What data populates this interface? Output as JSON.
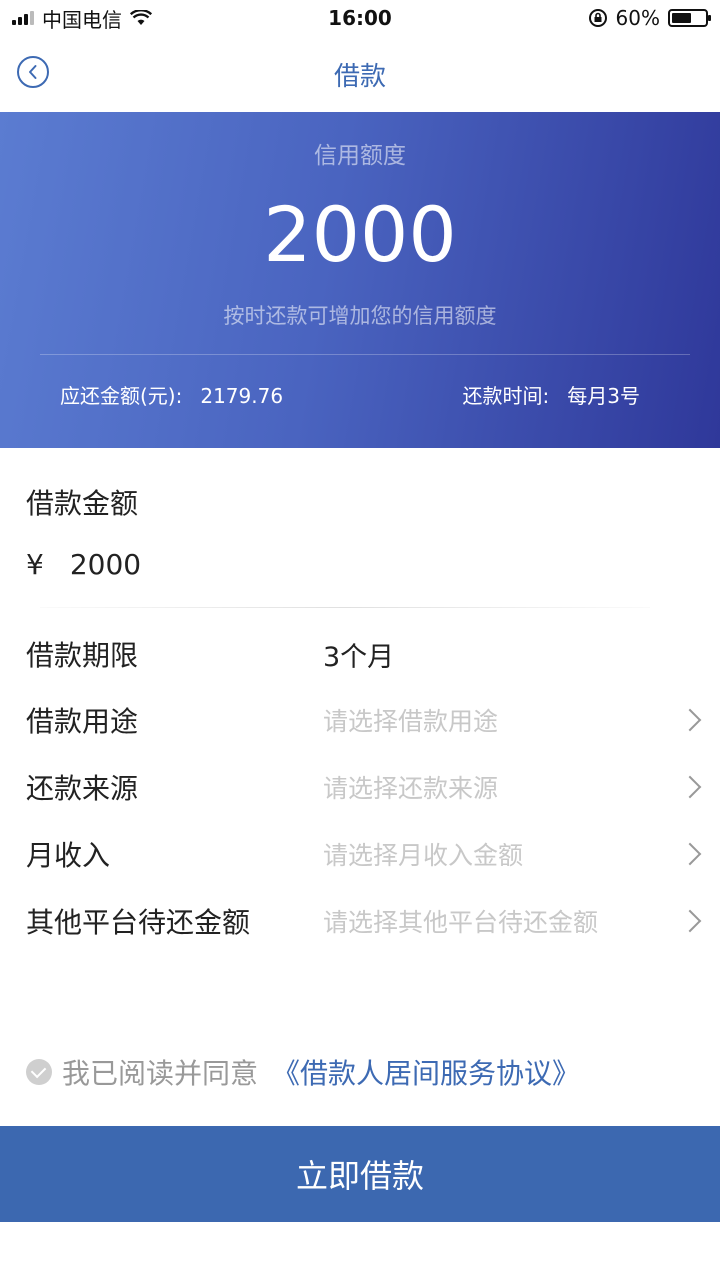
{
  "status_bar": {
    "carrier": "中国电信",
    "time": "16:00",
    "battery_percent": "60%",
    "battery_level": 0.6,
    "icons": [
      "signal-icon",
      "wifi-icon",
      "rotation-lock-icon",
      "battery-icon"
    ]
  },
  "nav": {
    "title": "借款",
    "back_icon": "chevron-left-icon"
  },
  "hero": {
    "label": "信用额度",
    "amount": "2000",
    "tip": "按时还款可增加您的信用额度",
    "repay_amount_label": "应还金额(元):",
    "repay_amount_value": "2179.76",
    "repay_time_label": "还款时间:",
    "repay_time_value": "每月3号"
  },
  "loan": {
    "title": "借款金额",
    "currency": "¥",
    "amount": "2000"
  },
  "form": {
    "term_label": "借款期限",
    "term_value": "3个月",
    "purpose_label": "借款用途",
    "purpose_placeholder": "请选择借款用途",
    "source_label": "还款来源",
    "source_placeholder": "请选择还款来源",
    "income_label": "月收入",
    "income_placeholder": "请选择月收入金额",
    "other_debt_label": "其他平台待还金额",
    "other_debt_placeholder": "请选择其他平台待还金额"
  },
  "agreement": {
    "text": "我已阅读并同意",
    "link": "《借款人居间服务协议》"
  },
  "submit": {
    "label": "立即借款"
  },
  "colors": {
    "accent": "#3c68b0",
    "hero_start": "#5b7cd1",
    "hero_end": "#2f389a"
  }
}
